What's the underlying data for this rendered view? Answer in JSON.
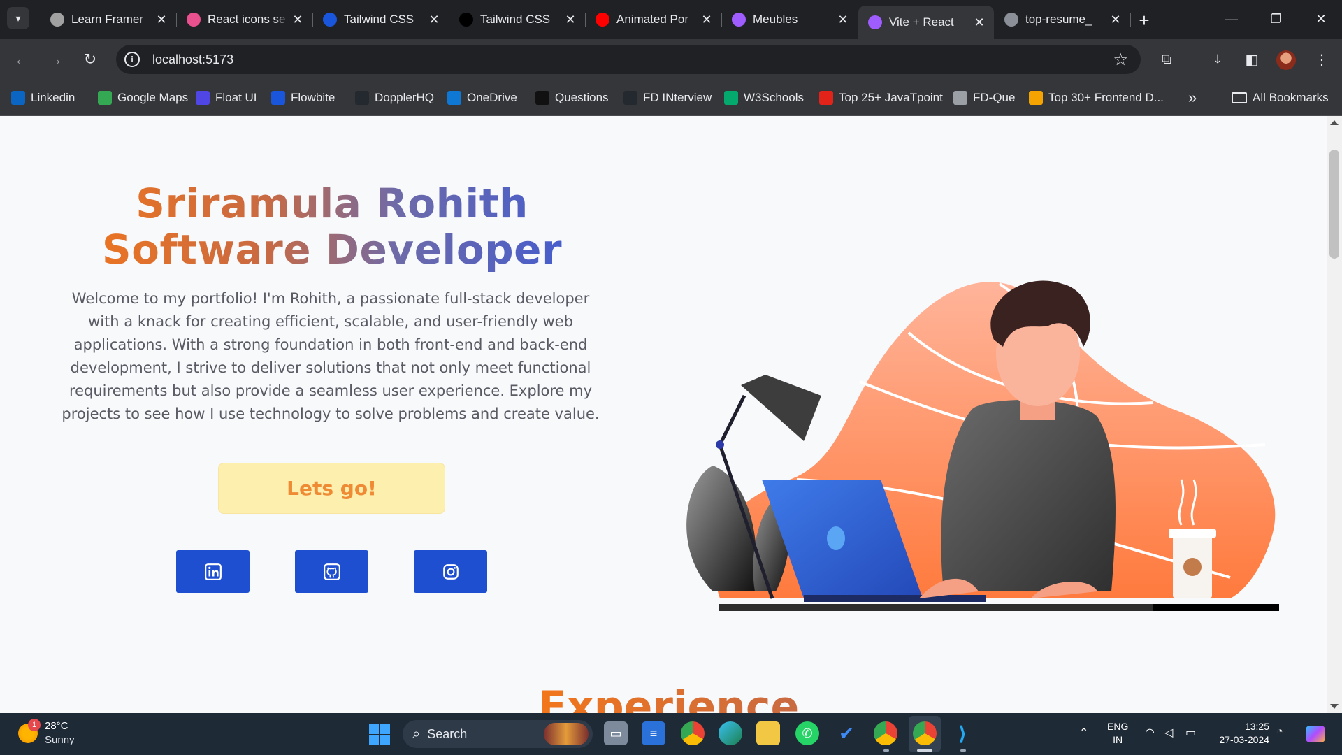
{
  "browser": {
    "tabs": [
      {
        "title": "Learn Framer",
        "favicon": "chatgpt-icon",
        "color": "#a1a1a1"
      },
      {
        "title": "React icons se",
        "favicon": "react-icon",
        "color": "#e8508e"
      },
      {
        "title": "Tailwind CSS",
        "favicon": "tailwind-icon",
        "color": "#1a56db"
      },
      {
        "title": "Tailwind CSS",
        "favicon": "ui-icon",
        "color": "#000000"
      },
      {
        "title": "Animated Por",
        "favicon": "youtube-icon",
        "color": "#ff0000"
      },
      {
        "title": "Meubles",
        "favicon": "vite-icon",
        "color": "#9f5cff"
      },
      {
        "title": "Vite + React",
        "favicon": "vite-icon",
        "color": "#9f5cff",
        "active": true
      },
      {
        "title": "top-resume_",
        "favicon": "globe-icon",
        "color": "#8a8f98"
      }
    ],
    "close_glyph": "✕",
    "new_tab_glyph": "+",
    "address": "localhost:5173",
    "bookmarks": [
      {
        "label": "Linkedin",
        "icon": "linkedin-icon",
        "color": "#0a66c2"
      },
      {
        "label": "Google Maps",
        "icon": "maps-icon",
        "color": "#34a853"
      },
      {
        "label": "Float UI",
        "icon": "floatui-icon",
        "color": "#4f46e5"
      },
      {
        "label": "Flowbite",
        "icon": "flowbite-icon",
        "color": "#1a56db"
      },
      {
        "label": "DopplerHQ",
        "icon": "github-icon",
        "color": "#24292f"
      },
      {
        "label": "OneDrive",
        "icon": "onedrive-icon",
        "color": "#0f78d4"
      },
      {
        "label": "Questions",
        "icon": "notion-icon",
        "color": "#111111"
      },
      {
        "label": "FD INterview",
        "icon": "github-icon",
        "color": "#24292f"
      },
      {
        "label": "W3Schools",
        "icon": "w3schools-icon",
        "color": "#04aa6d"
      },
      {
        "label": "Top 25+ JavaTpoint",
        "icon": "javatpoint-icon",
        "color": "#e2231a"
      },
      {
        "label": "FD-Que",
        "icon": "mountain-icon",
        "color": "#9aa0a6"
      },
      {
        "label": "Top 30+ Frontend D...",
        "icon": "runner-icon",
        "color": "#f4a300"
      }
    ],
    "more_bookmarks_glyph": "»",
    "all_bookmarks": "All Bookmarks"
  },
  "page": {
    "title_line1": "Sriramula Rohith",
    "title_line2": "Software Developer",
    "intro": "Welcome to my portfolio! I'm Rohith, a passionate full-stack developer with a knack for creating efficient, scalable, and user-friendly web applications. With a strong foundation in both front-end and back-end development, I strive to deliver solutions that not only meet functional requirements but also provide a seamless user experience. Explore my projects to see how I use technology to solve problems and create value.",
    "cta": "Lets go!",
    "socials": [
      {
        "name": "linkedin-icon"
      },
      {
        "name": "github-icon"
      },
      {
        "name": "instagram-icon"
      }
    ],
    "next_section": "Experience",
    "colors": {
      "title_start": "#f2761b",
      "title_end": "#3d5ad5",
      "cta_bg": "#fdefae",
      "cta_text": "#ef8b34",
      "social_bg": "#1d4fd0"
    }
  },
  "taskbar": {
    "weather_badge": "1",
    "temperature": "28°C",
    "condition": "Sunny",
    "search": "Search",
    "lang_line1": "ENG",
    "lang_line2": "IN",
    "time": "13:25",
    "date": "27-03-2024"
  }
}
